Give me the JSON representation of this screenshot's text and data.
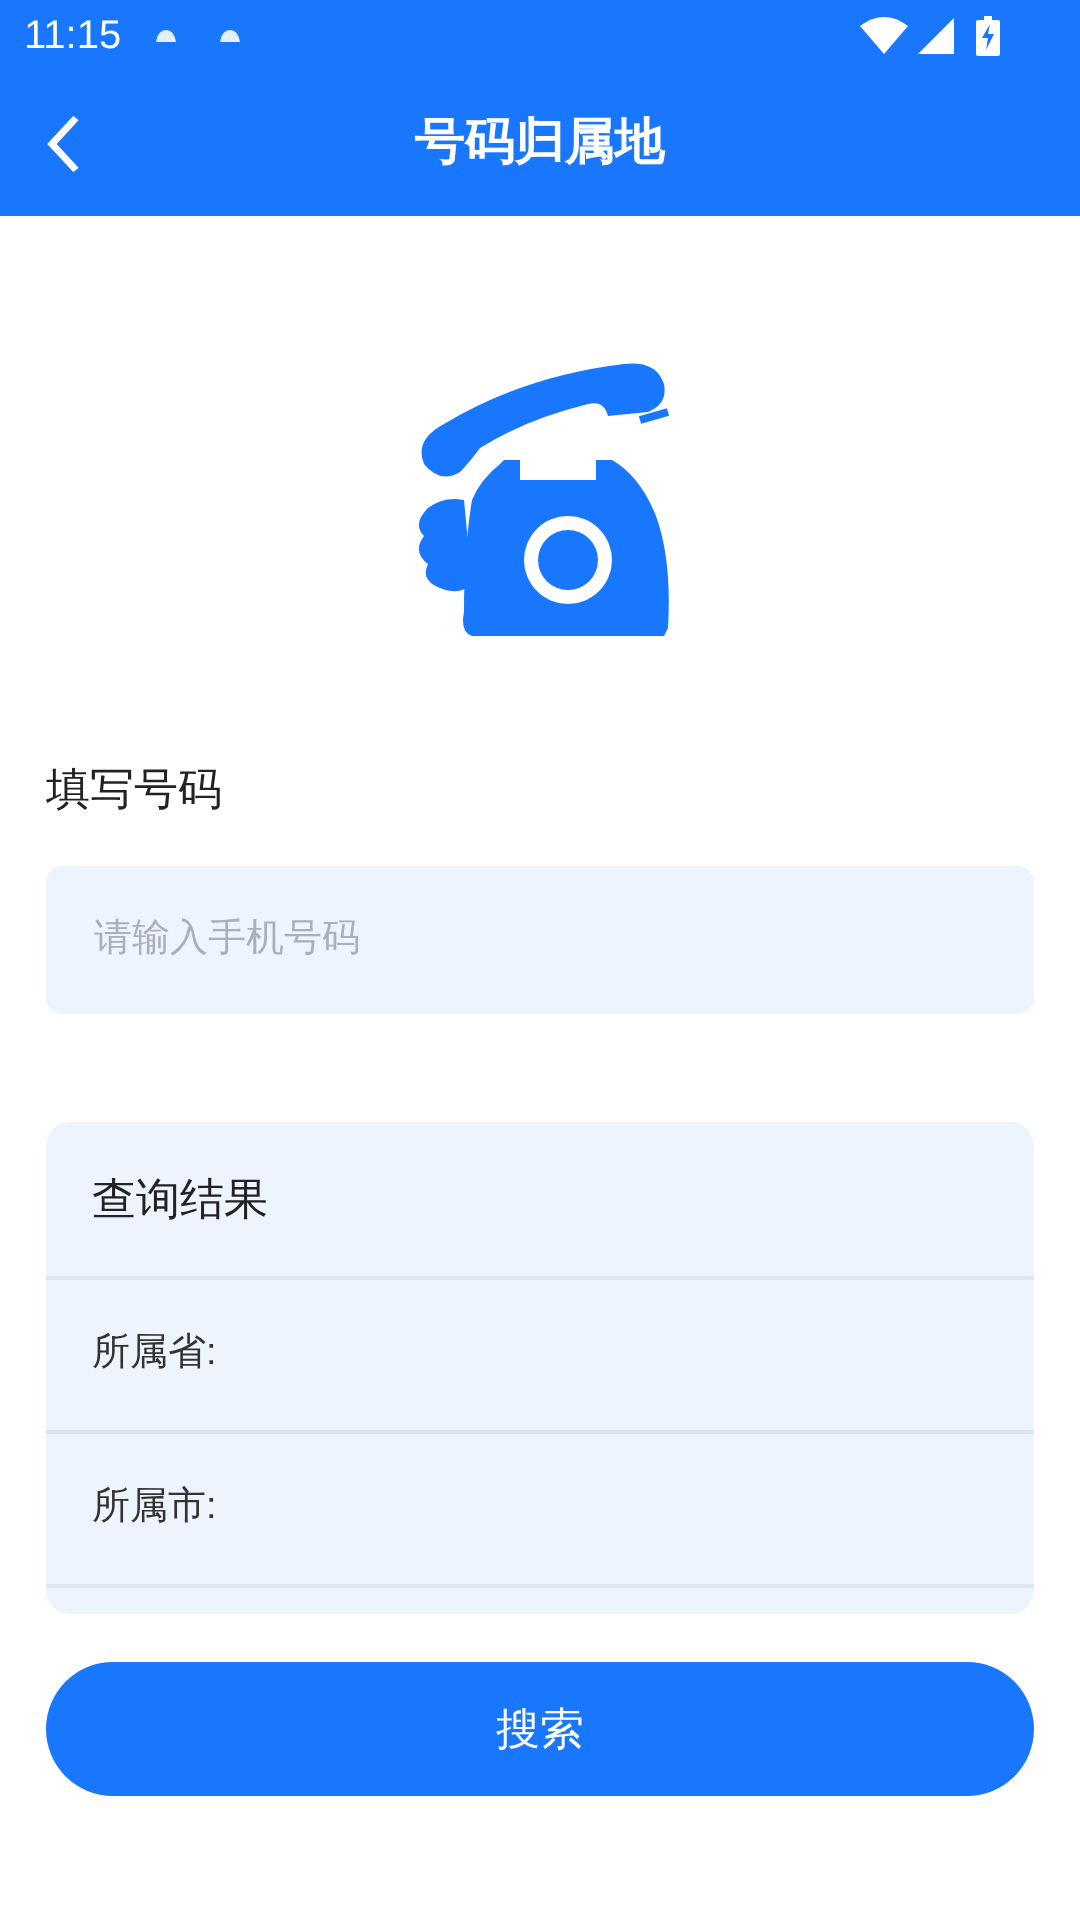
{
  "status_bar": {
    "time": "11:15"
  },
  "app_bar": {
    "title": "号码归属地"
  },
  "form": {
    "label": "填写号码",
    "input": {
      "placeholder": "请输入手机号码"
    }
  },
  "results": {
    "title": "查询结果",
    "rows": [
      {
        "label": "所属省:"
      },
      {
        "label": "所属市:"
      }
    ]
  },
  "search_button": {
    "label": "搜索"
  }
}
